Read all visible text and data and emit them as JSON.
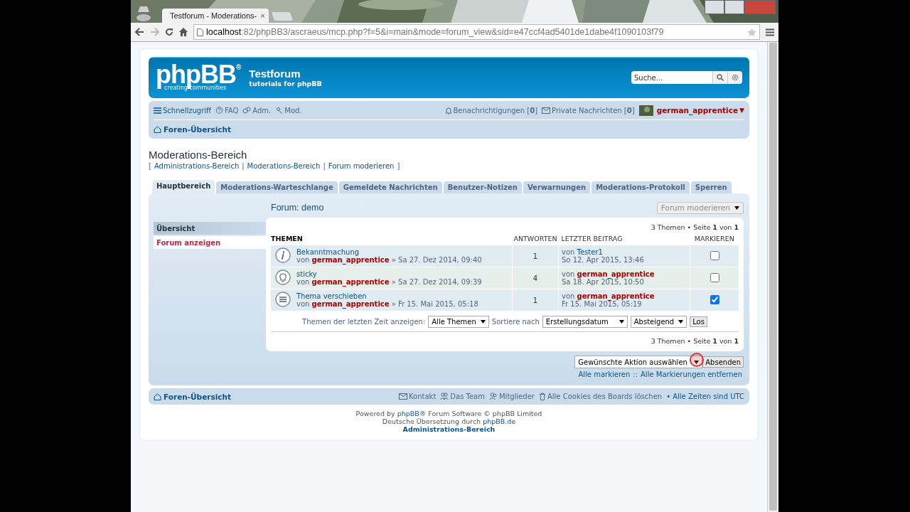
{
  "browser": {
    "tab_title": "Testforum - Moderations-",
    "tab_close": "×",
    "url_host": "localhost",
    "url_rest": ":82/phpBB3/ascraeus/mcp.php?f=5&i=main&mode=forum_view&sid=e47ccf4ad5401de1dabe4f1090103f79"
  },
  "header": {
    "logo": "phpBB",
    "logo_mark": "®",
    "logo_tagline": "creating communities",
    "site_title": "Testforum",
    "site_description": "tutorials for phpBB",
    "search": {
      "placeholder": "Suche..."
    }
  },
  "navbar": {
    "left": [
      {
        "kind": "menu",
        "label": "Schnellzugriff"
      },
      {
        "kind": "faq",
        "label": "FAQ"
      },
      {
        "kind": "admin",
        "label": "Adm."
      },
      {
        "kind": "mod",
        "label": "Mod."
      }
    ],
    "notifications": "Benachrichtigungen [**0**]",
    "messages": "Private Nachrichten [**0**]",
    "user": "german_apprentice",
    "user_caret": "▼",
    "breadcrumb": "Foren-Übersicht"
  },
  "page_title": "Moderations-Bereich",
  "crumbs": {
    "open": "[",
    "close": "]",
    "separator": "|",
    "links": [
      "Administrations-Bereich",
      "Moderations-Bereich",
      "Forum moderieren"
    ]
  },
  "tabs": [
    {
      "label": "Hauptbereich",
      "selected": true
    },
    {
      "label": "Moderations-Warteschlange",
      "selected": false
    },
    {
      "label": "Gemeldete Nachrichten",
      "selected": false
    },
    {
      "label": "Benutzer-Notizen",
      "selected": false
    },
    {
      "label": "Verwarnungen",
      "selected": false
    },
    {
      "label": "Moderations-Protokoll",
      "selected": false
    },
    {
      "label": "Sperren",
      "selected": false
    }
  ],
  "sidebar": {
    "heading": "Übersicht",
    "items": [
      {
        "label": "Forum anzeigen",
        "selected": true
      }
    ]
  },
  "forum": {
    "title": "Forum: demo",
    "tools_button": "Forum moderieren",
    "pagination": "3 Themen • Seite **1** von **1**",
    "columns": [
      "THEMEN",
      "ANTWORTEN",
      "LETZTER BEITRAG",
      "MARKIEREN"
    ],
    "rows": [
      {
        "kind": "announcement",
        "title": "Bekanntmachung",
        "by": "von",
        "author": "german_apprentice",
        "date": "» Sa 27. Dez 2014, 09:40",
        "replies": "1",
        "last_by": "von",
        "last_author": "Tester1",
        "color": "#105289",
        "last_date": "So 12. Apr 2015, 13:46",
        "checked": false
      },
      {
        "kind": "sticky",
        "title": "sticky",
        "by": "von",
        "author": "german_apprentice",
        "date": "» Sa 27. Dez 2014, 09:39",
        "replies": "4",
        "last_by": "von",
        "last_author": "german_apprentice",
        "color": "#aa0000",
        "last_date": "Sa 18. Apr 2015, 10:50",
        "checked": false
      },
      {
        "kind": "topic",
        "title": "Thema verschieben",
        "by": "von",
        "author": "german_apprentice",
        "date": "» Fr 15. Mai 2015, 05:18",
        "replies": "1",
        "last_by": "von",
        "last_author": "german_apprentice",
        "color": "#aa0000",
        "last_date": "Fr 15. Mai 2015, 05:19",
        "checked": true
      }
    ],
    "filter": {
      "label": "Themen der letzten Zeit anzeigen:",
      "days": "Alle Themen",
      "sort_label": "Sortiere nach",
      "sort_key": "Erstellungsdatum",
      "sort_dir": "Absteigend",
      "go": "Los"
    },
    "pagination_bottom": "3 Themen • Seite **1** von **1**"
  },
  "actions": {
    "select": "Gewünschte Aktion auswählen",
    "submit": "Absenden",
    "mark_all": "Alle markieren",
    "separator": "::",
    "unmark_all": "Alle Markierungen entfernen"
  },
  "footer": {
    "breadcrumb": "Foren-Übersicht",
    "links": [
      {
        "kind": "contact",
        "label": "Kontakt"
      },
      {
        "kind": "team",
        "label": "Das Team"
      },
      {
        "kind": "members",
        "label": "Mitglieder"
      },
      {
        "kind": "cookies",
        "label": "Alle Cookies des Boards löschen"
      }
    ],
    "timezone": "• Alle Zeiten sind UTC",
    "powered_prefix": "Powered by",
    "powered_link": "phpBB",
    "powered_suffix": "® Forum Software © phpBB Limited",
    "translation_prefix": "Deutsche Übersetzung durch",
    "translation_link": "phpBB.de",
    "admin_link": "Administrations-Bereich"
  }
}
